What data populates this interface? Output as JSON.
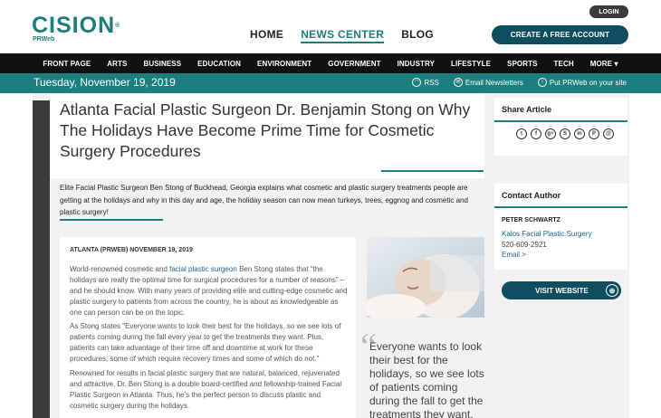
{
  "header": {
    "logo": "CISION",
    "logo_reg": "®",
    "logo_sub": "PRWeb",
    "nav": [
      "HOME",
      "NEWS CENTER",
      "BLOG"
    ],
    "login": "LOGIN",
    "create_account": "CREATE A FREE ACCOUNT"
  },
  "categories": [
    "FRONT PAGE",
    "ARTS",
    "BUSINESS",
    "EDUCATION",
    "ENVIRONMENT",
    "GOVERNMENT",
    "INDUSTRY",
    "LIFESTYLE",
    "SPORTS",
    "TECH",
    "MORE ▾"
  ],
  "date_bar": {
    "date": "Tuesday, November 19, 2019",
    "rss": "RSS",
    "newsletters": "Email Newsletters",
    "put_prweb": "Put PRWeb on your site"
  },
  "article": {
    "headline": "Atlanta Facial Plastic Surgeon Dr. Benjamin Stong on Why The Holidays Have Become Prime Time for Cosmetic Surgery Procedures",
    "summary": "Elite Facial Plastic Surgeon Ben Stong of Buckhead, Georgia explains what cosmetic and plastic surgery treatments people are getting at the holidays and why in this day and age, the holiday season can now mean turkeys, trees, eggnog and cosmetic and plastic surgery!",
    "dateline": "ATLANTA (PRWEB) NOVEMBER 19, 2019",
    "p1_pre": "World-renowned cosmetic and ",
    "p1_link": "facial plastic surgeon",
    "p1_post": " Ben Stong states that \"the holidays are really the optimal time for surgical procedures for a number of reasons\" – and he should know. With many years of providing elite and cutting-edge cosmetic and plastic surgery to patients from across the country, he is about as knowledgeable as one can person can be on the topic.",
    "p2": "As Stong states \"Everyone wants to look their best for the holidays, so we see lots of patients coming during the fall every year to get the treatments they want. Plus, patients can take advantage of their time off and downtime at work for these procedures, some of which require recovery times and some of which do not.\"",
    "p3": "Renowned for results in facial plastic surgery that are natural, balanced, rejuvenated and attractive, Dr. Ben Stong is a double board-certified and fellowship-trained Facial Plastic Surgeon in Atlanta. Thus, he's the perfect person to discuss plastic and cosmetic surgery during the holidays.",
    "pull_quote": "Everyone wants to look their best for the holidays, so we see lots of patients coming during the fall to get the treatments they want."
  },
  "sidebar": {
    "share_title": "Share Article",
    "share_icons": [
      "t",
      "f",
      "g+",
      "S",
      "in",
      "P",
      "@"
    ],
    "contact_title": "Contact Author",
    "contact_name": "PETER SCHWARTZ",
    "company": "Kalos Facial Plastic Surgery",
    "phone": "520-609-2921",
    "email": "Email >",
    "visit": "VISIT WEBSITE"
  },
  "colors": {
    "teal": "#1a7f7e",
    "navy_teal": "#0f4e5e",
    "nav_black": "#111111"
  }
}
